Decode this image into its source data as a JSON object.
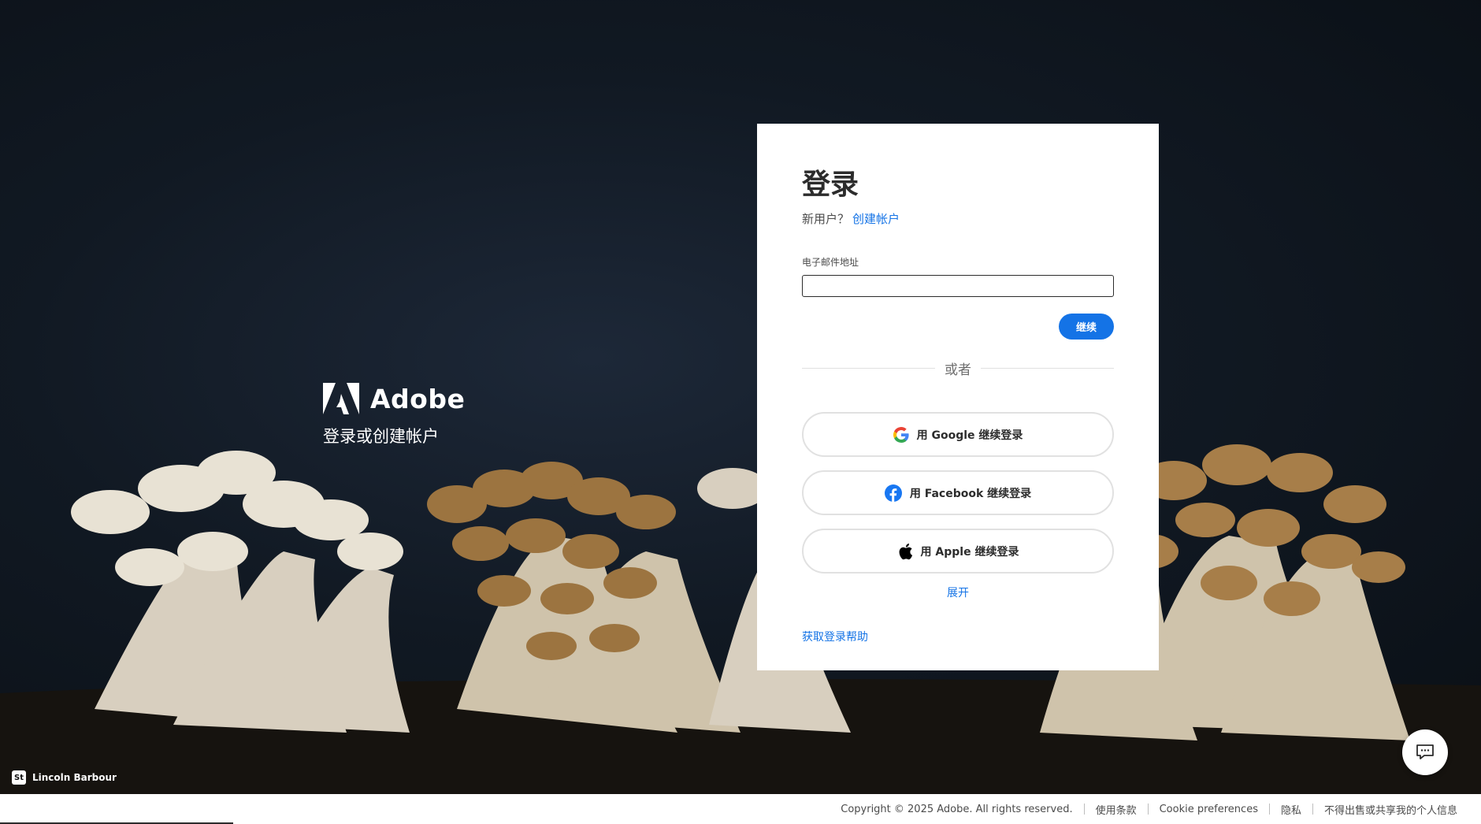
{
  "brand": {
    "name": "Adobe",
    "tagline": "登录或创建帐户"
  },
  "credit": {
    "badge": "St",
    "photographer": "Lincoln Barbour"
  },
  "login": {
    "title": "登录",
    "new_user_prompt": "新用户？",
    "create_account_link": "创建帐户",
    "email_label": "电子邮件地址",
    "email_value": "",
    "continue_label": "继续",
    "or_text": "或者",
    "google_label": "用 Google 继续登录",
    "facebook_label": "用 Facebook 继续登录",
    "apple_label": "用 Apple 继续登录",
    "expand_label": "展开",
    "help_link": "获取登录帮助"
  },
  "footer": {
    "copyright": "Copyright © 2025 Adobe. All rights reserved.",
    "terms": "使用条款",
    "cookies": "Cookie preferences",
    "privacy": "隐私",
    "do_not_sell": "不得出售或共享我的个人信息"
  },
  "colors": {
    "accent": "#1473e6",
    "background": "#111923"
  },
  "icons": [
    "adobe-logo-icon",
    "google-icon",
    "facebook-icon",
    "apple-icon",
    "chat-icon"
  ]
}
